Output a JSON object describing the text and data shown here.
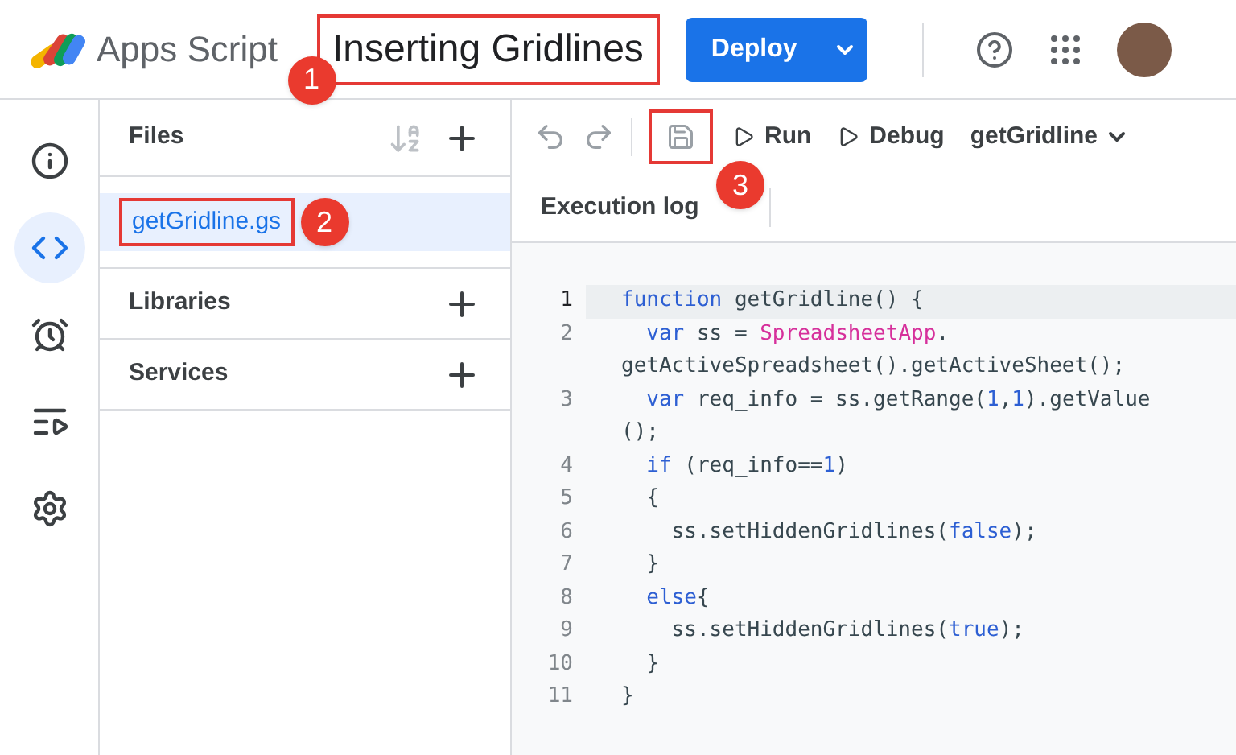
{
  "header": {
    "app_name": "Apps Script",
    "project_title": "Inserting Gridlines",
    "deploy_button": "Deploy"
  },
  "rail": [
    {
      "selected": false
    },
    {
      "selected": true
    },
    {
      "selected": false
    },
    {
      "selected": false
    },
    {
      "selected": false
    }
  ],
  "files_panel": {
    "title": "Files",
    "files": [
      {
        "name": "getGridline.gs",
        "selected": true
      }
    ],
    "sections": [
      {
        "title": "Libraries"
      },
      {
        "title": "Services"
      }
    ]
  },
  "toolbar": {
    "run": "Run",
    "debug": "Debug",
    "function": "getGridline",
    "execution_log": "Execution log"
  },
  "code": [
    {
      "number": "1",
      "selected": true,
      "rows": [
        [
          {
            "kind": "keyword",
            "text": "function"
          },
          {
            "kind": "plain",
            "text": " getGridline() {"
          }
        ]
      ]
    },
    {
      "number": "2",
      "selected": false,
      "rows": [
        [
          {
            "kind": "plain",
            "text": "  "
          },
          {
            "kind": "keyword",
            "text": "var"
          },
          {
            "kind": "plain",
            "text": " ss = "
          },
          {
            "kind": "class",
            "text": "SpreadsheetApp"
          },
          {
            "kind": "plain",
            "text": "."
          }
        ],
        [
          {
            "kind": "plain",
            "text": "getActiveSpreadsheet().getActiveSheet();"
          }
        ]
      ]
    },
    {
      "number": "3",
      "selected": false,
      "rows": [
        [
          {
            "kind": "plain",
            "text": "  "
          },
          {
            "kind": "keyword",
            "text": "var"
          },
          {
            "kind": "plain",
            "text": " req_info = ss.getRange("
          },
          {
            "kind": "number",
            "text": "1"
          },
          {
            "kind": "plain",
            "text": ","
          },
          {
            "kind": "number",
            "text": "1"
          },
          {
            "kind": "plain",
            "text": ").getValue"
          }
        ],
        [
          {
            "kind": "plain",
            "text": "();"
          }
        ]
      ]
    },
    {
      "number": "4",
      "selected": false,
      "rows": [
        [
          {
            "kind": "plain",
            "text": "  "
          },
          {
            "kind": "keyword",
            "text": "if"
          },
          {
            "kind": "plain",
            "text": " (req_info=="
          },
          {
            "kind": "number",
            "text": "1"
          },
          {
            "kind": "plain",
            "text": ")"
          }
        ]
      ]
    },
    {
      "number": "5",
      "selected": false,
      "rows": [
        [
          {
            "kind": "plain",
            "text": "  {"
          }
        ]
      ]
    },
    {
      "number": "6",
      "selected": false,
      "rows": [
        [
          {
            "kind": "plain",
            "text": "    ss.setHiddenGridlines("
          },
          {
            "kind": "keyword",
            "text": "false"
          },
          {
            "kind": "plain",
            "text": ");"
          }
        ]
      ]
    },
    {
      "number": "7",
      "selected": false,
      "rows": [
        [
          {
            "kind": "plain",
            "text": "  }"
          }
        ]
      ]
    },
    {
      "number": "8",
      "selected": false,
      "rows": [
        [
          {
            "kind": "plain",
            "text": "  "
          },
          {
            "kind": "keyword",
            "text": "else"
          },
          {
            "kind": "plain",
            "text": "{"
          }
        ]
      ]
    },
    {
      "number": "9",
      "selected": false,
      "rows": [
        [
          {
            "kind": "plain",
            "text": "    ss.setHiddenGridlines("
          },
          {
            "kind": "keyword",
            "text": "true"
          },
          {
            "kind": "plain",
            "text": ");"
          }
        ]
      ]
    },
    {
      "number": "10",
      "selected": false,
      "rows": [
        [
          {
            "kind": "plain",
            "text": "  }"
          }
        ]
      ]
    },
    {
      "number": "11",
      "selected": false,
      "rows": [
        [
          {
            "kind": "plain",
            "text": "}"
          }
        ]
      ]
    }
  ],
  "annotations": [
    "1",
    "2",
    "3"
  ]
}
